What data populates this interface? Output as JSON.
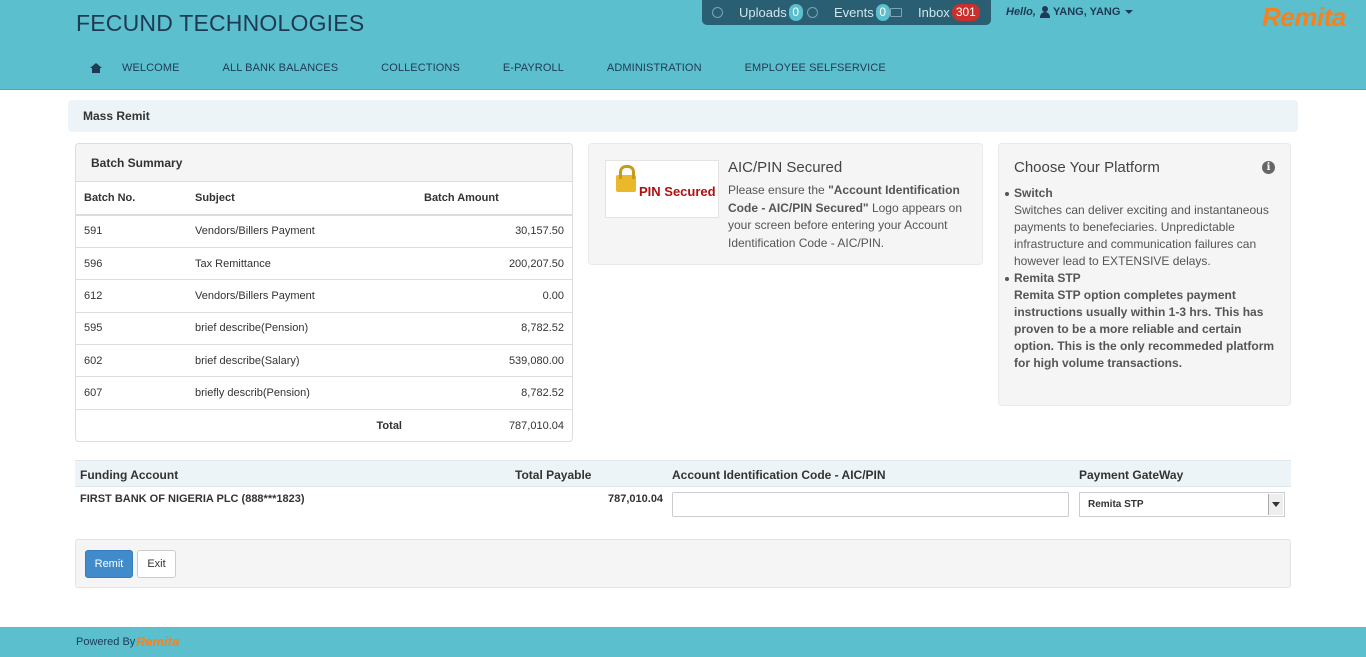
{
  "header": {
    "brand": "FECUND TECHNOLOGIES",
    "notifications": {
      "uploads_label": "Uploads",
      "uploads_count": "0",
      "events_label": "Events",
      "events_count": "0",
      "inbox_label": "Inbox",
      "inbox_count": "301"
    },
    "greeting": "Hello,",
    "user": "YANG, YANG",
    "logo": "Remita"
  },
  "nav": {
    "items": [
      "WELCOME",
      "ALL BANK BALANCES",
      "COLLECTIONS",
      "E-PAYROLL",
      "ADMINISTRATION",
      "EMPLOYEE SELFSERVICE"
    ]
  },
  "page_title": "Mass Remit",
  "batch_summary": {
    "title": "Batch Summary",
    "columns": [
      "Batch No.",
      "Subject",
      "Batch Amount"
    ],
    "rows": [
      [
        "591",
        "Vendors/Billers Payment",
        "30,157.50"
      ],
      [
        "596",
        "Tax Remittance",
        "200,207.50"
      ],
      [
        "612",
        "Vendors/Billers Payment",
        "0.00"
      ],
      [
        "595",
        "brief describe(Pension)",
        "8,782.52"
      ],
      [
        "602",
        "brief describe(Salary)",
        "539,080.00"
      ],
      [
        "607",
        "briefly describ(Pension)",
        "8,782.52"
      ]
    ],
    "total_label": "Total",
    "total_value": "787,010.04"
  },
  "pin_secured": {
    "logo_text": "PIN Secured",
    "title": "AIC/PIN Secured",
    "desc_prefix": "Please ensure the ",
    "desc_bold": "\"Account Identification Code - AIC/PIN Secured\"",
    "desc_suffix": " Logo appears on your screen before entering your Account Identification Code - AIC/PIN."
  },
  "platform": {
    "title": "Choose Your Platform",
    "options": [
      {
        "name": "Switch",
        "text": "Switches can deliver exciting and instantaneous payments to benefeciaries. Unpredictable infrastructure and communication failures can however lead to EXTENSIVE delays."
      },
      {
        "name": "Remita STP",
        "text": "Remita STP option completes payment instructions usually within 1-3 hrs. This has proven to be a more reliable and certain option. This is the only recommeded platform for high volume transactions."
      }
    ]
  },
  "funding": {
    "columns": {
      "account": "Funding Account",
      "total": "Total Payable",
      "aic": "Account Identification Code - AIC/PIN",
      "gateway": "Payment GateWay"
    },
    "account": "FIRST BANK OF NIGERIA PLC (888***1823)",
    "total": "787,010.04",
    "aic_value": "",
    "gateway_selected": "Remita STP"
  },
  "actions": {
    "remit": "Remit",
    "exit": "Exit"
  },
  "footer": {
    "powered_by": "Powered By",
    "logo": "Remita"
  },
  "colors": {
    "header_bg": "#5bbfcd",
    "notif_bg": "#2a5f73",
    "brand_orange": "#f5821f",
    "primary_button": "#428bca",
    "inbox_badge": "#c9302c"
  }
}
